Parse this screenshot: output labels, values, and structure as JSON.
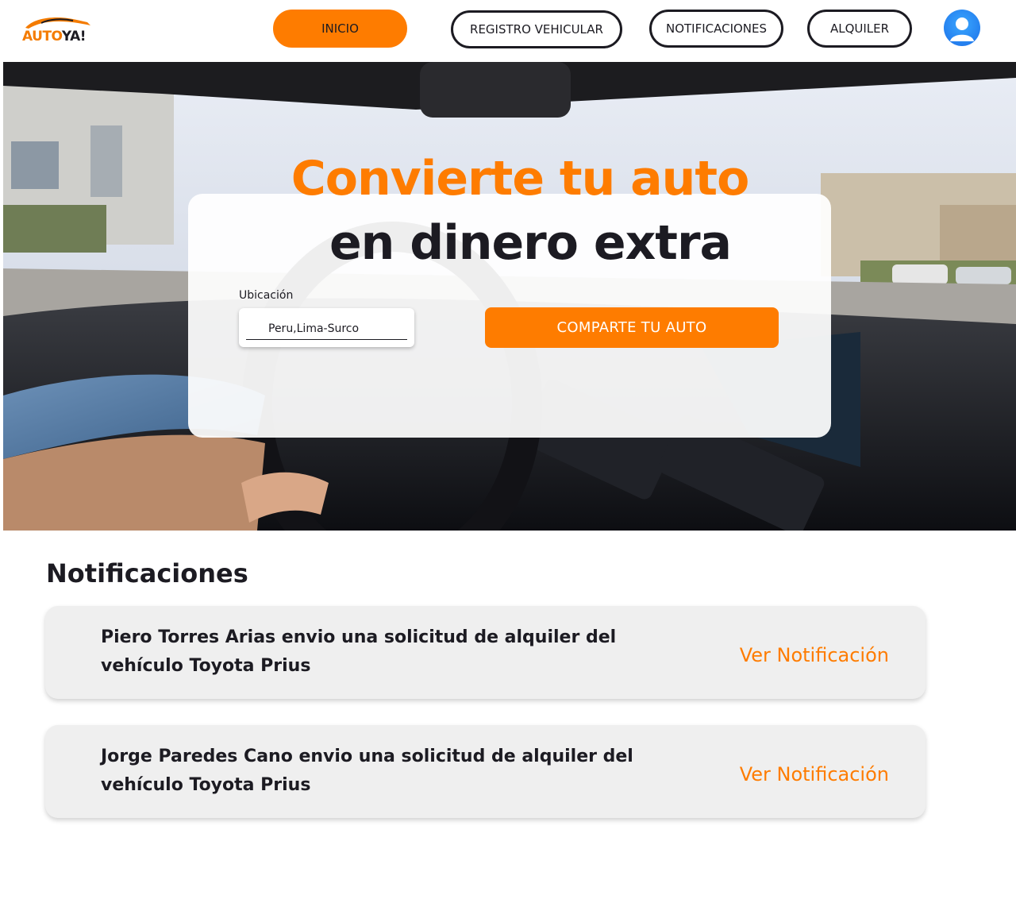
{
  "header": {
    "logo": {
      "part1": "AUTO",
      "part2": "YA!"
    },
    "nav": [
      {
        "label": "INICIO",
        "active": true
      },
      {
        "label": "REGISTRO VEHICULAR",
        "active": false
      },
      {
        "label": "NOTIFICACIONES",
        "active": false
      },
      {
        "label": "ALQUILER",
        "active": false
      }
    ],
    "avatar_icon": "user-profile-icon"
  },
  "hero": {
    "title_line1": "Convierte tu auto",
    "title_line2": "en dinero extra",
    "location_label": "Ubicación",
    "location_value": "Peru,Lima-Surco",
    "cta_label": "COMPARTE TU AUTO",
    "background": "car-interior-photo"
  },
  "notifications": {
    "title": "Notificaciones",
    "items": [
      {
        "message": "Piero Torres Arias envio una solicitud de alquiler del vehículo Toyota Prius",
        "action": "Ver Notificación"
      },
      {
        "message": "Jorge Paredes Cano envio una solicitud de alquiler del vehículo Toyota Prius",
        "action": "Ver Notificación"
      }
    ]
  },
  "colors": {
    "accent": "#fe7c00",
    "text": "#1c1b22",
    "card": "#efefef"
  }
}
